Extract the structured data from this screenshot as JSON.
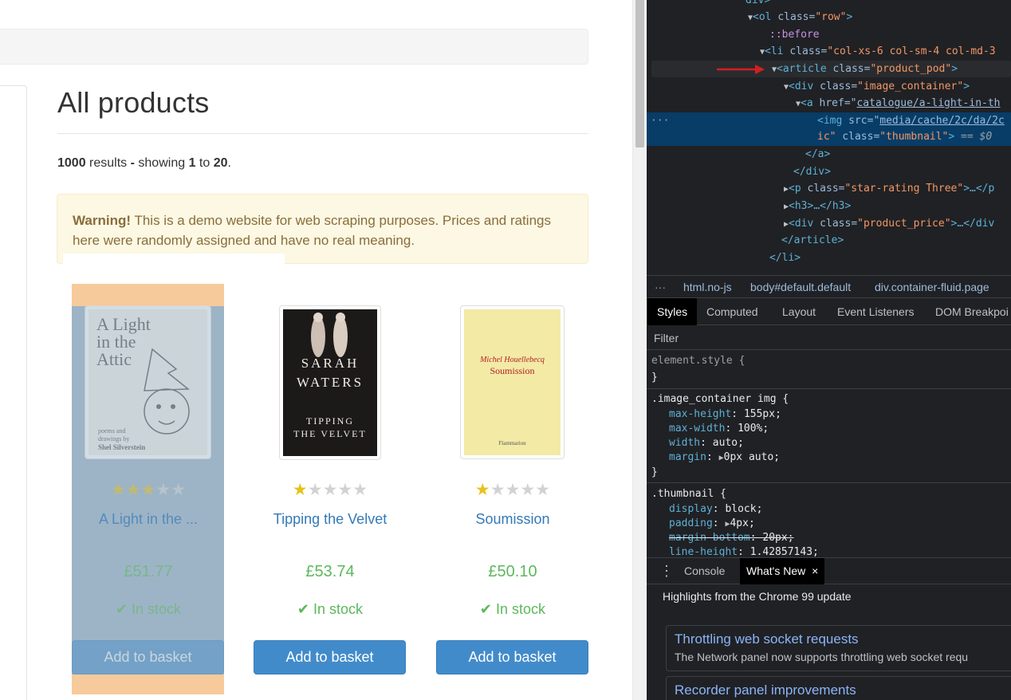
{
  "page": {
    "title": "All products",
    "results": {
      "total": "1000",
      "word_results": "results",
      "dash": "-",
      "showing": "showing",
      "from": "1",
      "to_word": "to",
      "to": "20",
      "period": "."
    },
    "warning": {
      "label": "Warning!",
      "text": "This is a demo website for web scraping purposes. Prices and ratings here were randomly assigned and have no real meaning."
    },
    "products": [
      {
        "title": "A Light in the ...",
        "rating": 3,
        "price": "£51.77",
        "availability": "In stock",
        "button": "Add to basket",
        "cover": {
          "line1": "A Light",
          "line2": "in the",
          "line3": "Attic",
          "sub1": "poems and",
          "sub2": "drawings by",
          "author": "Shel Silverstein"
        }
      },
      {
        "title": "Tipping the Velvet",
        "rating": 1,
        "price": "£53.74",
        "availability": "In stock",
        "button": "Add to basket",
        "cover": {
          "author1": "SARAH",
          "author2": "WATERS",
          "title1": "TIPPING",
          "title2": "THE VELVET"
        }
      },
      {
        "title": "Soumission",
        "rating": 1,
        "price": "£50.10",
        "availability": "In stock",
        "button": "Add to basket",
        "cover": {
          "author": "Michel Houellebecq",
          "title": "Soumission",
          "publisher": "Flammarion"
        }
      }
    ]
  },
  "devtools": {
    "dom": {
      "l0": "div>",
      "l1_tag": "ol",
      "l1_attr": "class",
      "l1_val": "\"row\"",
      "l2": "::before",
      "l3_tag": "li",
      "l3_attr": "class",
      "l3_val": "\"col-xs-6 col-sm-4 col-md-3",
      "l4_tag": "article",
      "l4_attr": "class",
      "l4_val": "\"product_pod\"",
      "l5_tag": "div",
      "l5_attr": "class",
      "l5_val": "\"image_container\"",
      "l6_tag": "a",
      "l6_attr": "href",
      "l6_val": "catalogue/a-light-in-th",
      "l7_tag": "img",
      "l7_attr": "src",
      "l7_val": "media/cache/2c/da/2c",
      "l8_a": "ic\"",
      "l8_attr": "class",
      "l8_val": "\"thumbnail\"",
      "l8_eq": "== $0",
      "l9": "</a>",
      "l10": "</div>",
      "l11_tag": "p",
      "l11_attr": "class",
      "l11_val": "\"star-rating Three\"",
      "l11_end": "…</p",
      "l12": "<h3>…</h3>",
      "l13_tag": "div",
      "l13_attr": "class",
      "l13_val": "\"product_price\"",
      "l13_end": "…</div",
      "l14": "</article>",
      "l15": "</li>",
      "ellipsis": "···"
    },
    "breadcrumb": [
      "···",
      "html.no-js",
      "body#default.default",
      "div.container-fluid.page"
    ],
    "style_tabs": [
      "Styles",
      "Computed",
      "Layout",
      "Event Listeners",
      "DOM Breakpoi"
    ],
    "filter_placeholder": "Filter",
    "css": {
      "r1_sel": "element.style {",
      "r1_end": "}",
      "r2_sel": ".image_container img {",
      "r2_p1": "max-height",
      "r2_v1": "155px;",
      "r2_p2": "max-width",
      "r2_v2": "100%;",
      "r2_p3": "width",
      "r2_v3": "auto;",
      "r2_p4": "margin",
      "r2_v4": "0px auto;",
      "r2_end": "}",
      "r3_sel": ".thumbnail {",
      "r3_p1": "display",
      "r3_v1": "block;",
      "r3_p2": "padding",
      "r3_v2": "4px;",
      "r3_p3": "margin-bottom",
      "r3_v3": "20px;",
      "r3_p4": "line-height",
      "r3_v4": "1.42857143;"
    },
    "drawer_tabs": [
      "Console",
      "What's New"
    ],
    "drawer_close": "×",
    "highlights": "Highlights from the Chrome 99 update",
    "news": [
      {
        "title": "Throttling web socket requests",
        "desc": "The Network panel now supports throttling web socket requ"
      },
      {
        "title": "Recorder panel improvements",
        "desc": ""
      }
    ]
  },
  "colors": {
    "link": "#337ab7",
    "price": "#5cb85c",
    "button": "#428bca",
    "warning_bg": "#fcf8e3",
    "highlight_blue": "#6fa8dc",
    "highlight_orange": "#f7ca9b",
    "devtools_bg": "#202124"
  }
}
